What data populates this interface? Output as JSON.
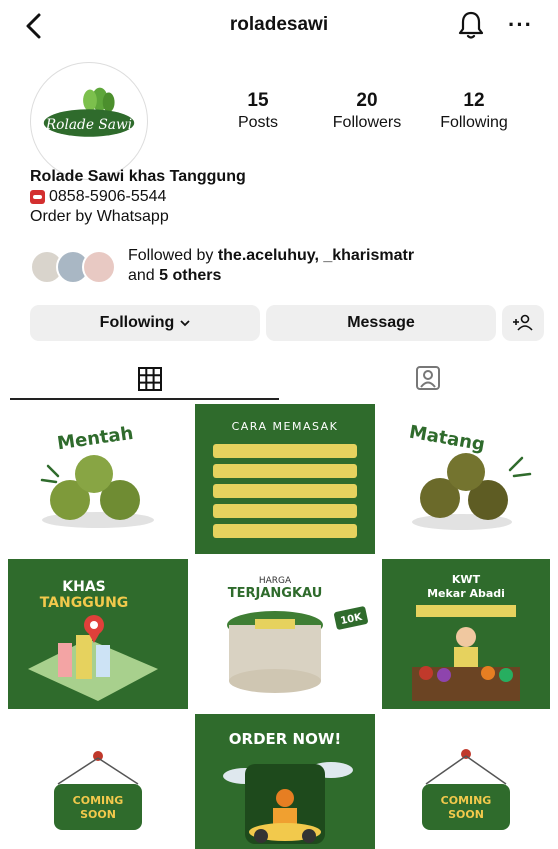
{
  "header": {
    "username": "roladesawi",
    "back_icon": "chevron-left-icon",
    "bell_icon": "bell-icon",
    "more_icon": "more-icon",
    "more_label": "···"
  },
  "profile": {
    "logo_text": "Rolade Sawi",
    "stats": [
      {
        "value": "15",
        "label": "Posts"
      },
      {
        "value": "20",
        "label": "Followers"
      },
      {
        "value": "12",
        "label": "Following"
      }
    ],
    "bio": {
      "name": "Rolade Sawi khas Tanggung",
      "phone": "0858-5906-5544",
      "line": "Order by Whatsapp"
    },
    "followed_by": {
      "prefix": "Followed by ",
      "users": "the.aceluhuy, _kharismatr",
      "and": "and ",
      "others": "5 others"
    }
  },
  "actions": {
    "following": "Following",
    "message": "Message",
    "add_user_icon": "add-user-icon"
  },
  "tabs": {
    "grid_icon": "grid-icon",
    "tagged_icon": "tagged-icon",
    "active": "grid"
  },
  "colors": {
    "brand_green": "#2f6b2c",
    "light_green": "#3f7e34",
    "button_gray": "#efefef"
  },
  "posts": {
    "mentah": "Mentah",
    "cara_memasak": "CARA MEMASAK",
    "matang": "Matang",
    "khas": "KHAS",
    "tanggung": "TANGGUNG",
    "harga": "HARGA",
    "terjangkau": "TERJANGKAU",
    "price": "10K",
    "kwt": "KWT",
    "mekar_abadi": "Mekar Abadi",
    "order_now": "ORDER NOW!",
    "coming": "COMING",
    "soon": "SOON"
  }
}
